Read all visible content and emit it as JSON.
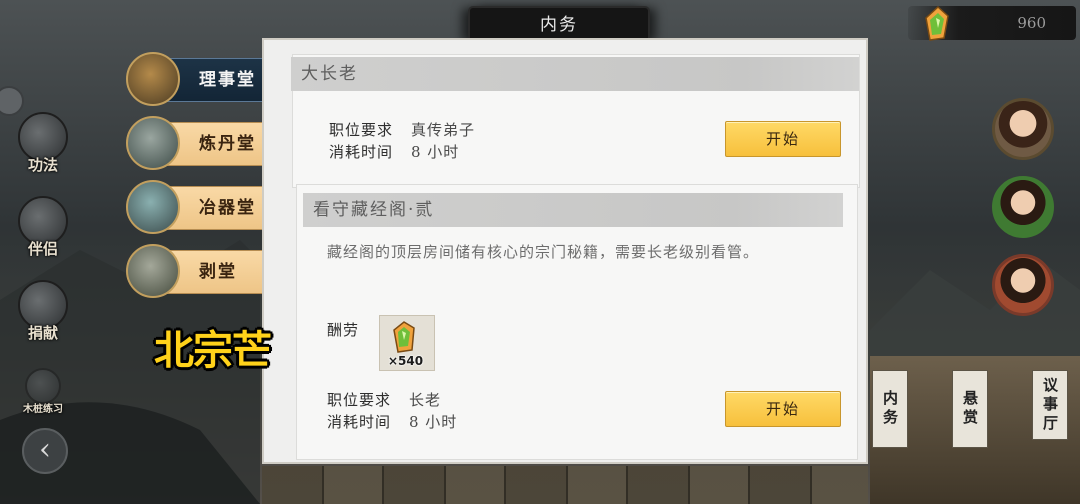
{
  "header": {
    "title": "内务",
    "currency_value": "960"
  },
  "left_menu": {
    "items": [
      {
        "label": "功法"
      },
      {
        "label": "伴侣"
      },
      {
        "label": "捐献"
      },
      {
        "label": "木桩练习"
      }
    ],
    "back_icon": "chevron-left-icon"
  },
  "hall_tabs": [
    {
      "label": "理事堂",
      "active": true
    },
    {
      "label": "炼丹堂",
      "active": false
    },
    {
      "label": "冶器堂",
      "active": false
    },
    {
      "label": "剥堂",
      "active": false
    }
  ],
  "watermark": "北宗芒",
  "tasks": [
    {
      "title": "大长老",
      "req_label": "职位要求",
      "req_value": "真传弟子",
      "time_label": "消耗时间",
      "time_value": "8 小时",
      "button": "开始"
    },
    {
      "title": "看守藏经阁·贰",
      "description": "藏经阁的顶层房间储有核心的宗门秘籍，需要长老级别看管。",
      "reward_label": "酬劳",
      "reward_count": "×540",
      "reward_icon": "spirit-stone-icon",
      "req_label": "职位要求",
      "req_value": "长老",
      "time_label": "消耗时间",
      "time_value": "8 小时",
      "button": "开始"
    }
  ],
  "right_menu": {
    "buttons": [
      {
        "label": "内务"
      },
      {
        "label": "悬赏"
      },
      {
        "label": "议事厅"
      }
    ]
  }
}
